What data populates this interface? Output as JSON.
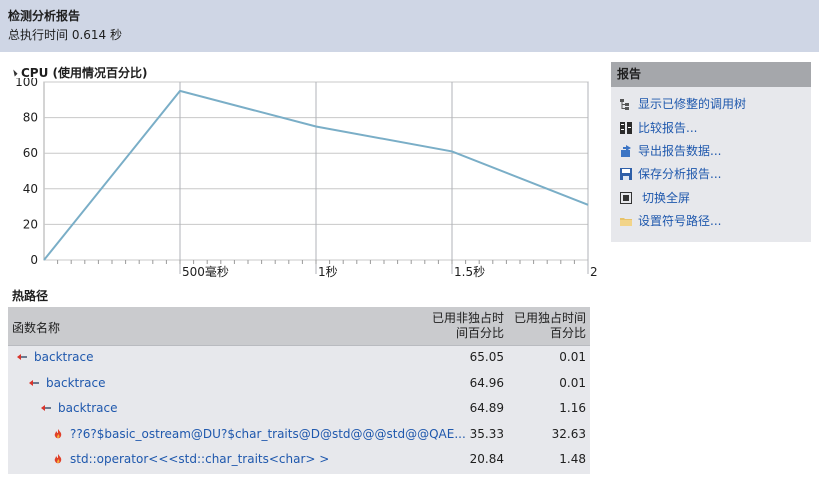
{
  "header": {
    "title": "检测分析报告",
    "subtitle": "总执行时间 0.614 秒"
  },
  "cpu": {
    "title": "CPU (使用情况百分比)"
  },
  "chart_data": {
    "type": "line",
    "title": "CPU (使用情况百分比)",
    "x": [
      0,
      0.5,
      1.0,
      1.5,
      2.0
    ],
    "series": [
      {
        "values": [
          0,
          95,
          75,
          61,
          31
        ]
      }
    ],
    "xlim": [
      0,
      2.0
    ],
    "ylim": [
      0,
      100
    ],
    "y_ticks": [
      "100",
      "80",
      "60",
      "40",
      "20",
      "0"
    ],
    "x_tick_labels": [
      "500毫秒",
      "1秒",
      "1.5秒",
      "2"
    ],
    "grid": true,
    "line_color": "#7aaec7"
  },
  "hotpath": {
    "title": "热路径",
    "columns": {
      "name": "函数名称",
      "inclusive": "已用非独占时间百分比",
      "exclusive": "已用独占时间百分比"
    },
    "rows": [
      {
        "name": "backtrace",
        "inclusive": "65.05",
        "exclusive": "0.01",
        "icon": "call-arrow-icon"
      },
      {
        "name": "backtrace",
        "inclusive": "64.96",
        "exclusive": "0.01",
        "icon": "call-arrow-icon"
      },
      {
        "name": "backtrace",
        "inclusive": "64.89",
        "exclusive": "1.16",
        "icon": "call-arrow-icon"
      },
      {
        "name": "??6?$basic_ostream@DU?$char_traits@D@std@@@std@@QAE...",
        "inclusive": "35.33",
        "exclusive": "32.63",
        "icon": "hot-flame-icon"
      },
      {
        "name": "std::operator<<<std::char_traits<char> >",
        "inclusive": "20.84",
        "exclusive": "1.48",
        "icon": "hot-flame-icon"
      }
    ]
  },
  "report_panel": {
    "title": "报告",
    "links": [
      {
        "label": "显示已修整的调用树",
        "icon": "tree-icon"
      },
      {
        "label": "比较报告...",
        "icon": "compare-icon"
      },
      {
        "label": "导出报告数据...",
        "icon": "export-icon"
      },
      {
        "label": "保存分析报告...",
        "icon": "save-icon"
      },
      {
        "label": "切换全屏",
        "icon": "fullscreen-icon"
      },
      {
        "label": "设置符号路径...",
        "icon": "folder-icon"
      }
    ]
  }
}
